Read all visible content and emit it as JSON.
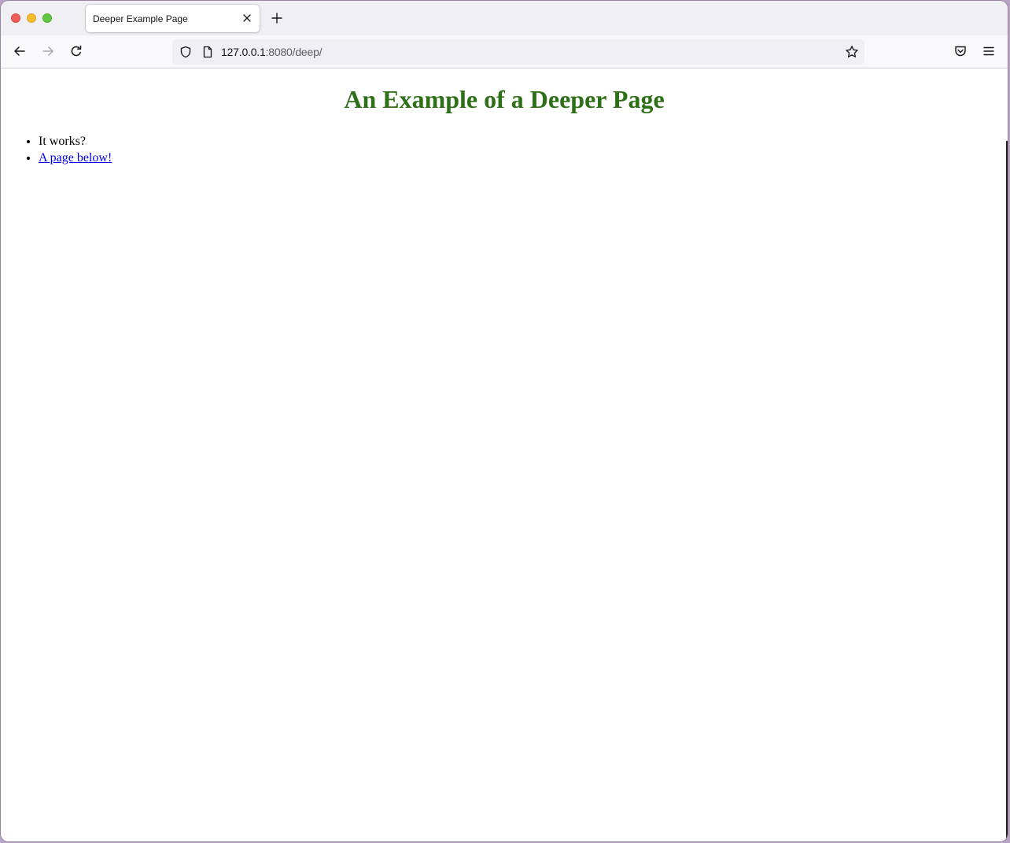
{
  "browser": {
    "tab": {
      "title": "Deeper Example Page"
    },
    "url": {
      "host": "127.0.0.1",
      "rest": ":8080/deep/"
    },
    "icons": {
      "back": "arrow-left-icon",
      "forward": "arrow-right-icon",
      "reload": "reload-icon",
      "shield": "shield-icon",
      "page": "page-icon",
      "bookmark": "star-icon",
      "pocket": "pocket-icon",
      "menu": "hamburger-menu-icon",
      "close_tab": "close-icon",
      "new_tab": "plus-icon"
    }
  },
  "page": {
    "heading": "An Example of a Deeper Page",
    "heading_color": "#2e7018",
    "items": [
      {
        "text": "It works?"
      },
      {
        "text": "A page below!",
        "is_link": true
      }
    ],
    "link_color": "#0000ee"
  }
}
